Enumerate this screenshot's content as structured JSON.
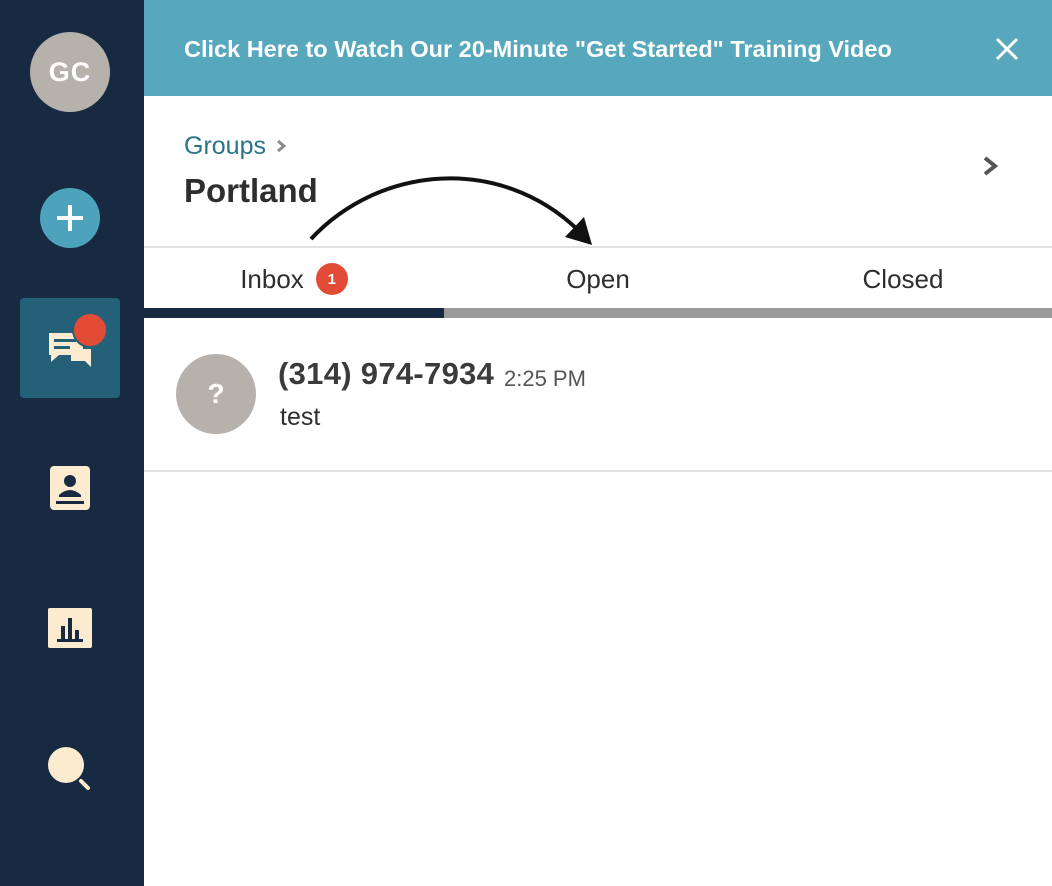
{
  "sidebar": {
    "avatar_initials": "GC",
    "items": [
      {
        "name": "add",
        "icon": "plus-icon"
      },
      {
        "name": "conversations",
        "icon": "chat-bubbles-icon",
        "active": true,
        "has_notification": true
      },
      {
        "name": "contacts",
        "icon": "contact-book-icon"
      },
      {
        "name": "reports",
        "icon": "bar-chart-icon"
      },
      {
        "name": "search",
        "icon": "search-icon"
      }
    ]
  },
  "banner": {
    "text": "Click Here to Watch Our 20-Minute \"Get Started\" Training Video",
    "close_icon": "close-icon"
  },
  "header": {
    "breadcrumb": "Groups",
    "title": "Portland"
  },
  "tabs": [
    {
      "label": "Inbox",
      "badge": "1",
      "active": true
    },
    {
      "label": "Open"
    },
    {
      "label": "Closed"
    }
  ],
  "conversations": [
    {
      "avatar": "?",
      "phone": "(314) 974-7934",
      "time": "2:25 PM",
      "snippet": "test"
    }
  ],
  "colors": {
    "sidebar": "#172a41",
    "banner": "#57a8bc",
    "accent": "#4ea3bc",
    "badge": "#e24b36",
    "active_nav": "#256079",
    "link": "#2a7488"
  }
}
